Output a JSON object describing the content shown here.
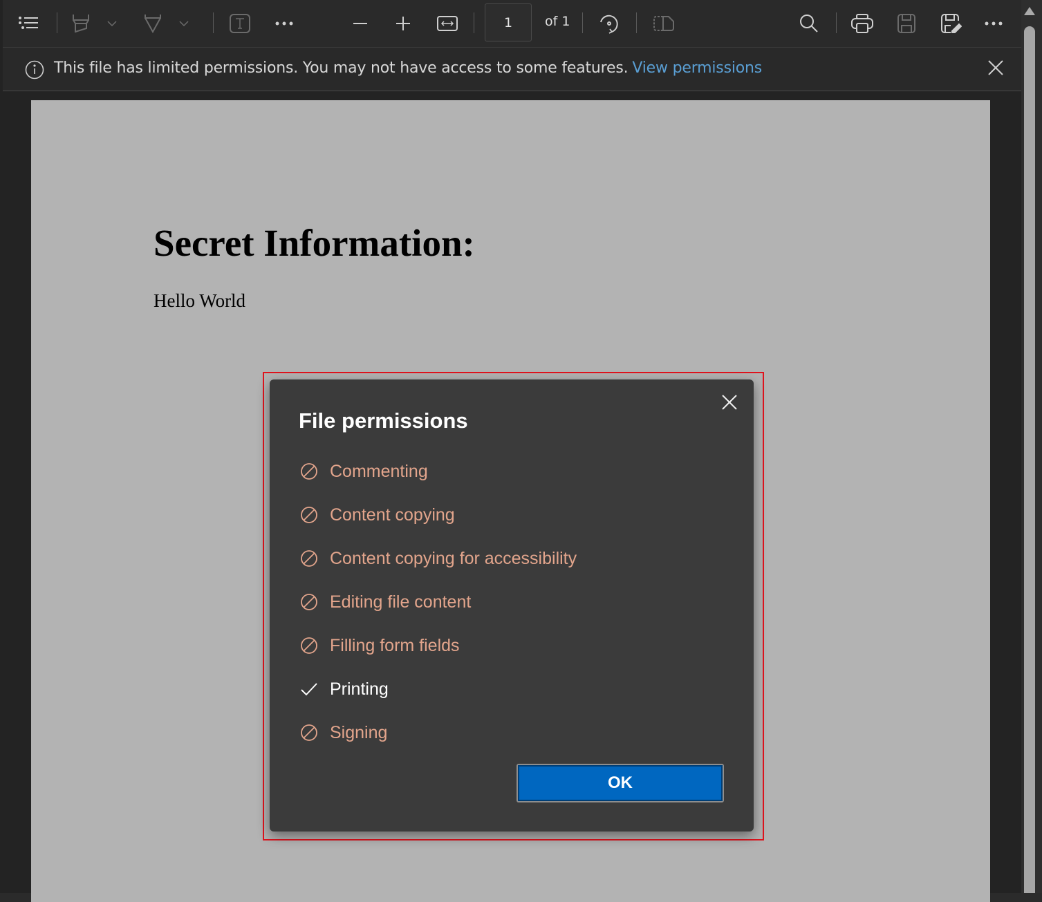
{
  "toolbar": {
    "page_current": "1",
    "page_total_label": "of 1",
    "icons": [
      "table-of-contents-icon",
      "highlight-icon",
      "draw-icon",
      "text-icon",
      "more-icon",
      "zoom-out-icon",
      "zoom-in-icon",
      "fit-width-icon",
      "rotate-icon",
      "page-view-icon",
      "search-icon",
      "print-icon",
      "save-icon",
      "save-as-icon",
      "more-options-icon"
    ]
  },
  "infobar": {
    "message": "This file has limited permissions. You may not have access to some features.",
    "link_label": "View permissions"
  },
  "document": {
    "title": "Secret Information:",
    "body": "Hello World"
  },
  "dialog": {
    "title": "File permissions",
    "ok_label": "OK",
    "permissions": [
      {
        "label": "Commenting",
        "allowed": false
      },
      {
        "label": "Content copying",
        "allowed": false
      },
      {
        "label": "Content copying for accessibility",
        "allowed": false
      },
      {
        "label": "Editing file content",
        "allowed": false
      },
      {
        "label": "Filling form fields",
        "allowed": false
      },
      {
        "label": "Printing",
        "allowed": true
      },
      {
        "label": "Signing",
        "allowed": false
      }
    ]
  },
  "colors": {
    "denied": "#e3a58c",
    "allowed": "#ffffff",
    "link": "#5a9fd4",
    "primary_button": "#0067c0",
    "highlight_box": "#e0131d"
  }
}
